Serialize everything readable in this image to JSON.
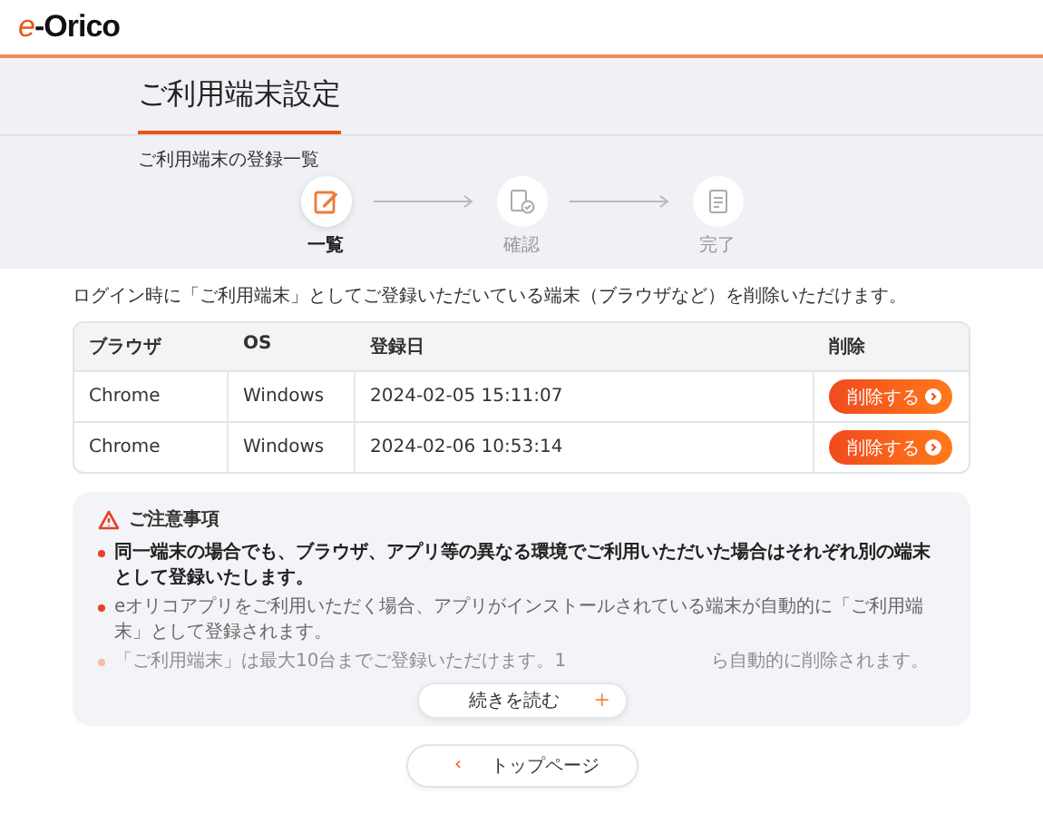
{
  "header": {
    "logo_prefix": "e",
    "logo_name": "-Orico"
  },
  "page_title": "ご利用端末設定",
  "section_caption": "ご利用端末の登録一覧",
  "steps": [
    {
      "label": "一覧",
      "selected": true,
      "kind": "edit"
    },
    {
      "label": "確認",
      "selected": false,
      "kind": "check"
    },
    {
      "label": "完了",
      "selected": false,
      "kind": "doc"
    }
  ],
  "intro": "ログイン時に「ご利用端末」としてご登録いただいている端末（ブラウザなど）を削除いただけます。",
  "table": {
    "columns": [
      "ブラウザ",
      "OS",
      "登録日",
      "削除"
    ],
    "rows": [
      {
        "browser": "Chrome",
        "os": "Windows",
        "registered": "2024-02-05 15:11:07",
        "action": "削除する"
      },
      {
        "browser": "Chrome",
        "os": "Windows",
        "registered": "2024-02-06 10:53:14",
        "action": "削除する"
      }
    ]
  },
  "notice": {
    "title": "ご注意事項",
    "items": [
      {
        "kind": "strong",
        "text": "同一端末の場合でも、ブラウザ、アプリ等の異なる環境でご利用いただいた場合はそれぞれ別の端末として登録いたします。"
      },
      {
        "kind": "normal",
        "text": "eオリコアプリをご利用いただく場合、アプリがインストールされている端末が自動的に「ご利用端末」として登録されます。"
      },
      {
        "kind": "faded",
        "text": "「ご利用端末」は最大10台までご登録いただけます。1",
        "text_after": "ら自動的に削除されます。"
      }
    ],
    "more_button": "続きを読む",
    "more_icon": "+"
  },
  "back_button": {
    "label": "トップページ",
    "icon": "‹"
  }
}
